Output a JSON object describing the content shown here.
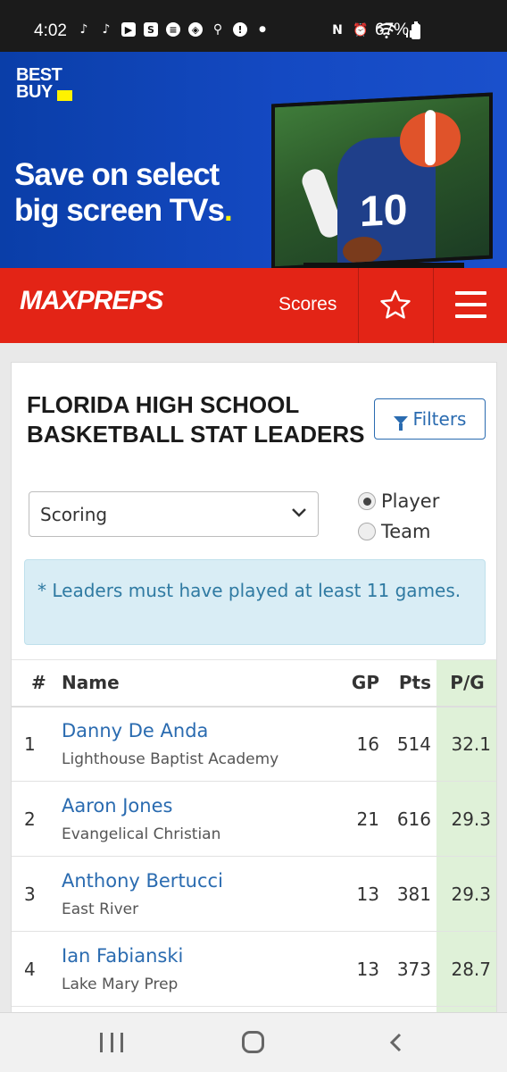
{
  "status_bar": {
    "time": "4:02",
    "battery": "67%",
    "icons_left": [
      "tiktok-icon",
      "tiktok-icon",
      "youtube-icon",
      "s-app-icon",
      "news-icon",
      "chase-icon",
      "location-icon",
      "alert-icon",
      "dot-icon"
    ],
    "icons_right": [
      "nfc-icon",
      "alarm-icon",
      "wifi-icon",
      "signal-icon",
      "battery-icon"
    ]
  },
  "ad": {
    "brand_line1": "BEST",
    "brand_line2": "BUY",
    "headline_line1": "Save on select",
    "headline_line2": "big screen TVs",
    "headline_dot": ".",
    "jersey_number": "10"
  },
  "header": {
    "logo": "MAXPREPS",
    "scores_label": "Scores",
    "accent_color": "#e32416"
  },
  "page": {
    "title": "FLORIDA HIGH SCHOOL BASKETBALL STAT LEADERS",
    "filters_label": "Filters",
    "stat_select_value": "Scoring",
    "radio_player": "Player",
    "radio_team": "Team",
    "radio_selected": "Player",
    "note": "* Leaders must have played at least 11 games."
  },
  "table": {
    "headers": {
      "rank": "#",
      "name": "Name",
      "gp": "GP",
      "pts": "Pts",
      "pg": "P/G"
    },
    "rows": [
      {
        "rank": "1",
        "name": "Danny De Anda",
        "school": "Lighthouse Baptist Academy",
        "gp": "16",
        "pts": "514",
        "pg": "32.1"
      },
      {
        "rank": "2",
        "name": "Aaron Jones",
        "school": "Evangelical Christian",
        "gp": "21",
        "pts": "616",
        "pg": "29.3"
      },
      {
        "rank": "3",
        "name": "Anthony Bertucci",
        "school": "East River",
        "gp": "13",
        "pts": "381",
        "pg": "29.3"
      },
      {
        "rank": "4",
        "name": "Ian Fabianski",
        "school": "Lake Mary Prep",
        "gp": "13",
        "pts": "373",
        "pg": "28.7"
      }
    ]
  }
}
